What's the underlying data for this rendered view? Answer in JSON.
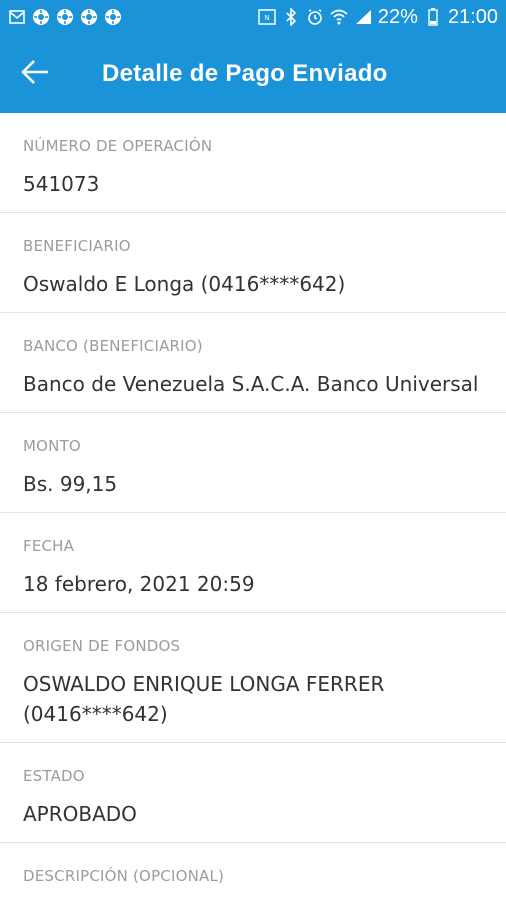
{
  "status_bar": {
    "icons_left": [
      "mail-icon",
      "sun-icon",
      "sun-icon",
      "sun-icon",
      "sun-icon"
    ],
    "battery_text": "22%",
    "time": "21:00"
  },
  "header": {
    "title": "Detalle de Pago Enviado"
  },
  "details": [
    {
      "label": "NÚMERO DE OPERACIÓN",
      "value": "541073"
    },
    {
      "label": "BENEFICIARIO",
      "value": "Oswaldo E Longa (0416****642)"
    },
    {
      "label": "BANCO (BENEFICIARIO)",
      "value": "Banco de Venezuela S.A.C.A. Banco Universal"
    },
    {
      "label": "MONTO",
      "value": "Bs. 99,15"
    },
    {
      "label": "FECHA",
      "value": "18 febrero, 2021 20:59"
    },
    {
      "label": "ORIGEN DE FONDOS",
      "value": "OSWALDO ENRIQUE LONGA FERRER (0416****642)"
    },
    {
      "label": "ESTADO",
      "value": "APROBADO"
    },
    {
      "label": "DESCRIPCIÓN (OPCIONAL)",
      "value": ""
    }
  ],
  "colors": {
    "primary": "#1a93d9",
    "label": "#9c9c9c",
    "value": "#333333",
    "divider": "#e3e3e3"
  }
}
